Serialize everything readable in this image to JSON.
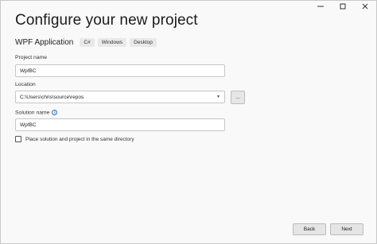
{
  "window": {
    "minimize_icon": "minimize-icon",
    "maximize_icon": "maximize-icon",
    "close_icon": "close-icon"
  },
  "header": {
    "title": "Configure your new project",
    "template_name": "WPF Application",
    "tags": [
      "C#",
      "Windows",
      "Desktop"
    ]
  },
  "form": {
    "project_name_label": "Project name",
    "project_name_value": "WpfBC",
    "location_label": "Location",
    "location_value": "C:\\Users\\chris\\source\\repos",
    "browse_label": "...",
    "solution_name_label": "Solution name",
    "solution_name_value": "WpfBC",
    "same_dir_label": "Place solution and project in the same directory",
    "same_dir_checked": false
  },
  "footer": {
    "back_label": "Back",
    "next_label": "Next"
  },
  "colors": {
    "background": "#f9f9f9",
    "info_accent": "#2a6ebb"
  }
}
